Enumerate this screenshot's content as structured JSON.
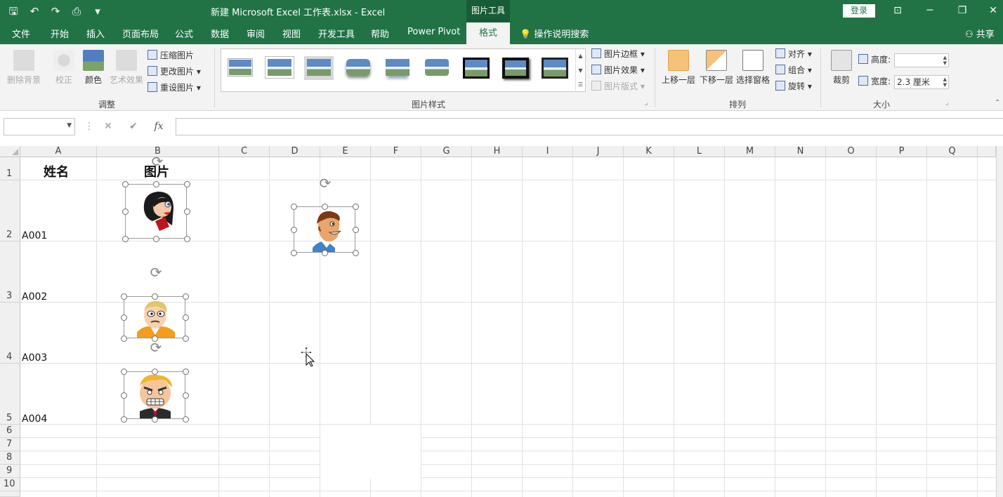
{
  "window": {
    "title": "新建 Microsoft Excel 工作表.xlsx  -  Excel",
    "context_tab_group": "图片工具",
    "login_label": "登录",
    "quick_access": [
      "save-icon",
      "undo-icon",
      "redo-icon",
      "print-preview-icon",
      "customize-icon"
    ],
    "controls": [
      "ribbon-display-icon",
      "minimize-icon",
      "restore-icon",
      "close-icon"
    ]
  },
  "tabs": [
    "文件",
    "开始",
    "插入",
    "页面布局",
    "公式",
    "数据",
    "审阅",
    "视图",
    "开发工具",
    "帮助",
    "Power Pivot"
  ],
  "active_tab": "格式",
  "tell_me": "操作说明搜索",
  "share": "共享",
  "ribbon": {
    "adjust": {
      "label": "调整",
      "remove_bg": "删除背景",
      "correct": "校正",
      "color": "颜色",
      "artistic": "艺术效果",
      "compress": "压缩图片",
      "change": "更改图片",
      "reset": "重设图片"
    },
    "styles": {
      "label": "图片样式",
      "border": "图片边框",
      "effects": "图片效果",
      "layout": "图片版式"
    },
    "arrange": {
      "label": "排列",
      "bring_forward": "上移一层",
      "send_backward": "下移一层",
      "selection_pane": "选择窗格",
      "align": "对齐",
      "group": "组合",
      "rotate": "旋转"
    },
    "size": {
      "label": "大小",
      "crop": "裁剪",
      "height_label": "高度:",
      "height_value": "",
      "width_label": "宽度:",
      "width_value": "2.3 厘米"
    }
  },
  "formula_bar": {
    "name_box": "",
    "cancel_icon": "✕",
    "enter_icon": "✔",
    "fx": "fx",
    "formula": ""
  },
  "sheet": {
    "columns": [
      "A",
      "B",
      "C",
      "D",
      "E",
      "F",
      "G",
      "H",
      "I",
      "J",
      "K",
      "L",
      "M",
      "N",
      "O",
      "P",
      "Q"
    ],
    "rows": [
      "1",
      "2",
      "3",
      "4",
      "5",
      "6",
      "7",
      "8",
      "9",
      "10"
    ],
    "headers": {
      "A1": "姓名",
      "B1": "图片"
    },
    "cells": {
      "A2": "A001",
      "A3": "A002",
      "A4": "A003",
      "A5": "A004"
    }
  },
  "pictures": [
    "cartoon-woman-face",
    "cartoon-worried-man-face",
    "cartoon-angry-man-face",
    "cartoon-smiling-man-face"
  ]
}
